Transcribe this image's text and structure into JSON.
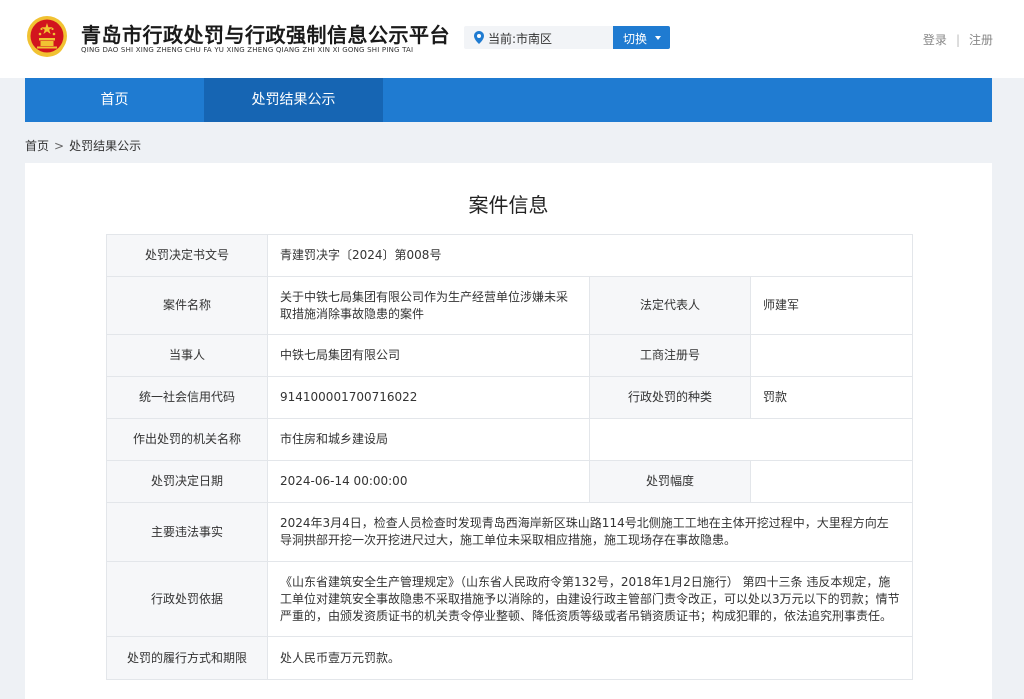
{
  "header": {
    "title": "青岛市行政处罚与行政强制信息公示平台",
    "subtitle": "QING DAO SHI XING ZHENG CHU FA YU XING ZHENG QIANG ZHI XIN XI GONG SHI PING TAI",
    "location": "当前:市南区",
    "switch_label": "切换",
    "login": "登录",
    "register": "注册",
    "separator": "|"
  },
  "nav": {
    "items": [
      {
        "label": "首页"
      },
      {
        "label": "处罚结果公示"
      }
    ]
  },
  "breadcrumb": {
    "home": "首页",
    "sep": ">",
    "current": "处罚结果公示"
  },
  "panel": {
    "title": "案件信息"
  },
  "case": {
    "doc_no": {
      "label": "处罚决定书文号",
      "value": "青建罚决字〔2024〕第008号"
    },
    "case_name": {
      "label": "案件名称",
      "value": "关于中铁七局集团有限公司作为生产经营单位涉嫌未采取措施消除事故隐患的案件"
    },
    "legal_rep": {
      "label": "法定代表人",
      "value": "师建军"
    },
    "party": {
      "label": "当事人",
      "value": "中铁七局集团有限公司"
    },
    "biz_reg_no": {
      "label": "工商注册号",
      "value": ""
    },
    "credit_code": {
      "label": "统一社会信用代码",
      "value": "914100001700716022"
    },
    "penalty_type": {
      "label": "行政处罚的种类",
      "value": "罚款"
    },
    "authority": {
      "label": "作出处罚的机关名称",
      "value": "市住房和城乡建设局"
    },
    "decision_date": {
      "label": "处罚决定日期",
      "value": "2024-06-14 00:00:00"
    },
    "penalty_range": {
      "label": "处罚幅度",
      "value": ""
    },
    "facts": {
      "label": "主要违法事实",
      "value": "2024年3月4日，检查人员检查时发现青岛西海岸新区珠山路114号北侧施工工地在主体开挖过程中，大里程方向左导洞拱部开挖一次开挖进尺过大，施工单位未采取相应措施，施工现场存在事故隐患。"
    },
    "basis": {
      "label": "行政处罚依据",
      "value": "《山东省建筑安全生产管理规定》（山东省人民政府令第132号，2018年1月2日施行） 第四十三条 违反本规定，施工单位对建筑安全事故隐患不采取措施予以消除的，由建设行政主管部门责令改正，可以处以3万元以下的罚款；情节严重的，由颁发资质证书的机关责令停业整顿、降低资质等级或者吊销资质证书；构成犯罪的，依法追究刑事责任。"
    },
    "fulfillment": {
      "label": "处罚的履行方式和期限",
      "value": "处人民币壹万元罚款。"
    }
  },
  "colors": {
    "brand": "#1f7bd1",
    "nav_active": "#1665b3",
    "emblem_red": "#d2141e",
    "emblem_gold": "#f1c232"
  },
  "icons": [
    "national-emblem-icon",
    "location-pin-icon",
    "caret-down-icon"
  ]
}
